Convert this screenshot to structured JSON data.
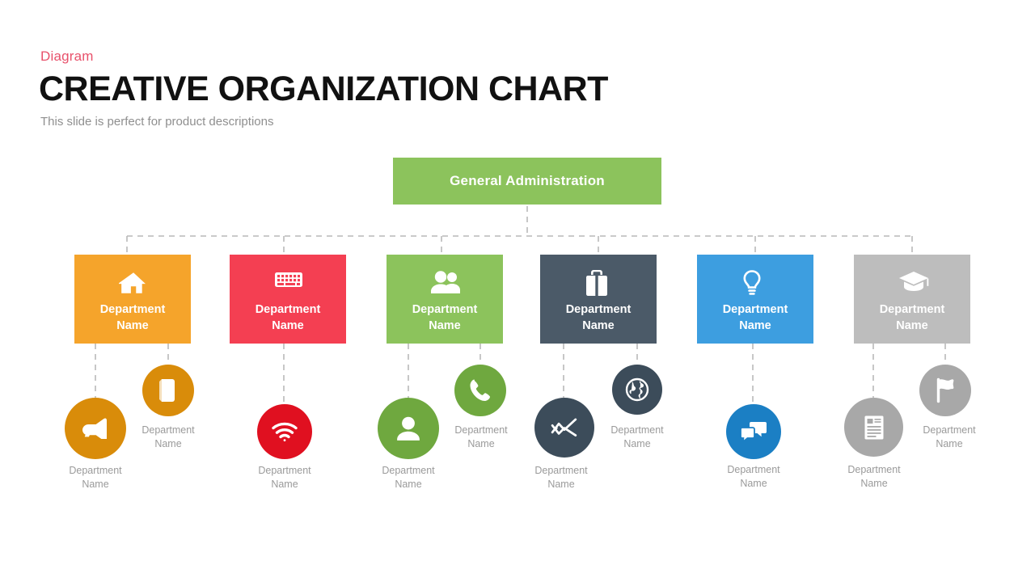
{
  "header": {
    "eyebrow": "Diagram",
    "title": "CREATIVE ORGANIZATION CHART",
    "subtitle": "This slide is perfect for product descriptions",
    "eyebrow_color": "#e8516b"
  },
  "root": {
    "label": "General Administration",
    "color": "#8cc35c"
  },
  "columns": [
    {
      "box": {
        "label_line1": "Department",
        "label_line2": "Name",
        "color": "#f5a42b",
        "icon": "home-icon"
      },
      "circle_color": "#d98c0a",
      "leaves": [
        {
          "label_line1": "Department",
          "label_line2": "Name",
          "icon": "megaphone-icon",
          "position": "lower-left"
        },
        {
          "label_line1": "Department",
          "label_line2": "Name",
          "icon": "book-icon",
          "position": "upper-right"
        }
      ]
    },
    {
      "box": {
        "label_line1": "Department",
        "label_line2": "Name",
        "color": "#f43f52",
        "icon": "keyboard-icon"
      },
      "circle_color": "#e01020",
      "leaves": [
        {
          "label_line1": "Department",
          "label_line2": "Name",
          "icon": "wifi-icon",
          "position": "lower-left"
        }
      ]
    },
    {
      "box": {
        "label_line1": "Department",
        "label_line2": "Name",
        "color": "#8cc35c",
        "icon": "users-icon"
      },
      "circle_color": "#6fa83f",
      "leaves": [
        {
          "label_line1": "Department",
          "label_line2": "Name",
          "icon": "user-icon",
          "position": "lower-left"
        },
        {
          "label_line1": "Department",
          "label_line2": "Name",
          "icon": "phone-icon",
          "position": "upper-right"
        }
      ]
    },
    {
      "box": {
        "label_line1": "Department",
        "label_line2": "Name",
        "color": "#4b5a68",
        "icon": "briefcase-icon"
      },
      "circle_color": "#3c4c5a",
      "leaves": [
        {
          "label_line1": "Department",
          "label_line2": "Name",
          "icon": "line-chart-icon",
          "position": "lower-left"
        },
        {
          "label_line1": "Department",
          "label_line2": "Name",
          "icon": "globe-icon",
          "position": "upper-right"
        }
      ]
    },
    {
      "box": {
        "label_line1": "Department",
        "label_line2": "Name",
        "color": "#3d9ee0",
        "icon": "lightbulb-icon"
      },
      "circle_color": "#1b7fc4",
      "leaves": [
        {
          "label_line1": "Department",
          "label_line2": "Name",
          "icon": "chat-icon",
          "position": "lower-left"
        }
      ]
    },
    {
      "box": {
        "label_line1": "Department",
        "label_line2": "Name",
        "color": "#bdbdbd",
        "icon": "graduation-cap-icon"
      },
      "circle_color": "#a8a8a8",
      "leaves": [
        {
          "label_line1": "Department",
          "label_line2": "Name",
          "icon": "document-icon",
          "position": "lower-left"
        },
        {
          "label_line1": "Department",
          "label_line2": "Name",
          "icon": "flag-icon",
          "position": "upper-right"
        }
      ]
    }
  ],
  "connector": {
    "color": "#b9b9b9",
    "style": "dashed"
  }
}
